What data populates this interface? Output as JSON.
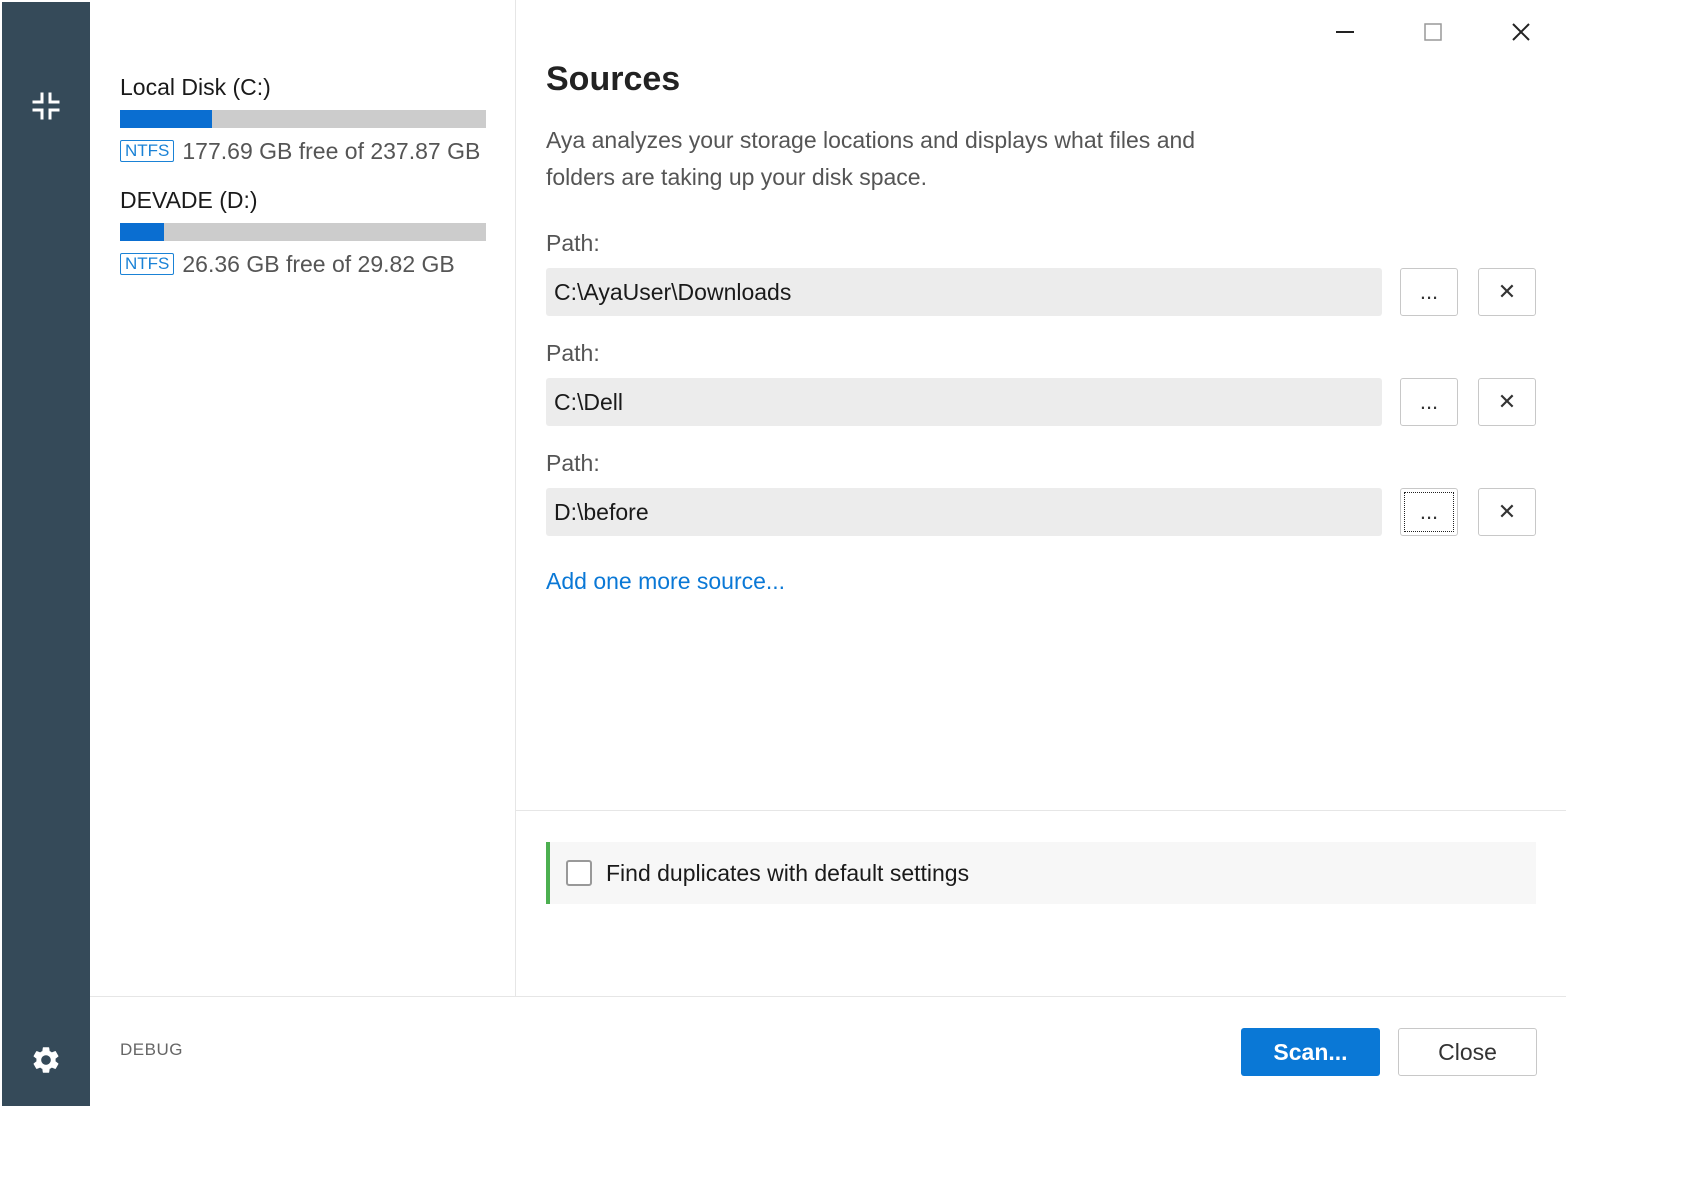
{
  "sidebar": {
    "collapse_icon": "collapse-arrows-icon",
    "settings_icon": "gear-icon"
  },
  "drives": [
    {
      "name": "Local Disk (C:)",
      "fs": "NTFS",
      "free_text": "177.69 GB free of 237.87 GB",
      "used_fraction": 0.25
    },
    {
      "name": "DEVADE (D:)",
      "fs": "NTFS",
      "free_text": "26.36 GB free of 29.82 GB",
      "used_fraction": 0.12
    }
  ],
  "window_controls": {
    "minimize": "minimize-icon",
    "maximize": "maximize-icon",
    "close": "close-icon"
  },
  "main": {
    "title": "Sources",
    "description": "Aya analyzes your storage locations and displays what files and folders are taking up your disk space.",
    "sources": [
      {
        "label": "Path:",
        "value": "C:\\AyaUser\\Downloads",
        "browse_label": "...",
        "remove_label": "✕"
      },
      {
        "label": "Path:",
        "value": "C:\\Dell",
        "browse_label": "...",
        "remove_label": "✕"
      },
      {
        "label": "Path:",
        "value": "D:\\before",
        "browse_label": "...",
        "remove_label": "✕"
      }
    ],
    "add_source_label": "Add one more source...",
    "duplicates_option": {
      "label": "Find duplicates with default settings",
      "checked": false
    }
  },
  "footer": {
    "debug_label": "DEBUG",
    "scan_label": "Scan...",
    "close_label": "Close"
  },
  "colors": {
    "rail": "#354a59",
    "accent": "#0a78d6",
    "bar_fill": "#0a6ed1",
    "bar_bg": "#cccccc",
    "option_border": "#4caf50"
  }
}
